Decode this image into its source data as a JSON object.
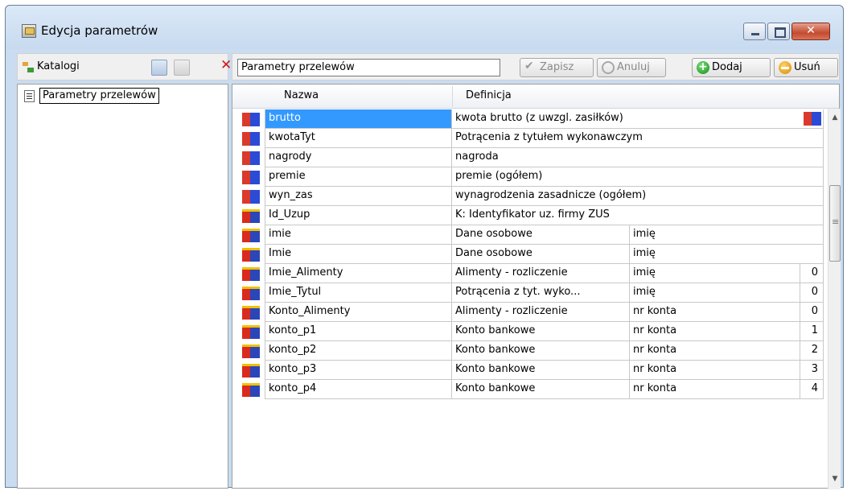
{
  "window": {
    "title": "Edycja parametrów"
  },
  "left_toolbar": {
    "label": "Katalogi"
  },
  "tree": {
    "items": [
      {
        "label": "Parametry przelewów"
      }
    ]
  },
  "right_toolbar": {
    "name_value": "Parametry przelewów",
    "save_label": "Zapisz",
    "cancel_label": "Anuluj",
    "add_label": "Dodaj",
    "delete_label": "Usuń"
  },
  "grid": {
    "columns": [
      "Nazwa",
      "Definicja"
    ],
    "rows": [
      {
        "type": "a",
        "name": "brutto",
        "definition": "kwota brutto (z uwzgl. zasiłków)",
        "field": "",
        "num": ""
      },
      {
        "type": "a",
        "name": "kwotaTyt",
        "definition": "Potrącenia z tytułem wykonawczym",
        "field": "",
        "num": ""
      },
      {
        "type": "a",
        "name": "nagrody",
        "definition": "nagroda",
        "field": "",
        "num": ""
      },
      {
        "type": "a",
        "name": "premie",
        "definition": "premie (ogółem)",
        "field": "",
        "num": ""
      },
      {
        "type": "a",
        "name": "wyn_zas",
        "definition": "wynagrodzenia zasadnicze (ogółem)",
        "field": "",
        "num": ""
      },
      {
        "type": "b",
        "name": "Id_Uzup",
        "definition": "K: Identyfikator uz. firmy ZUS",
        "field": "",
        "num": ""
      },
      {
        "type": "b",
        "name": "imie",
        "definition": "Dane osobowe",
        "field": "imię",
        "num": ""
      },
      {
        "type": "b",
        "name": "Imie",
        "definition": "Dane osobowe",
        "field": "imię",
        "num": ""
      },
      {
        "type": "b",
        "name": "Imie_Alimenty",
        "definition": "Alimenty - rozliczenie",
        "field": "imię",
        "num": "0"
      },
      {
        "type": "b",
        "name": "Imie_Tytul",
        "definition": "Potrącenia z tyt. wyko...",
        "field": "imię",
        "num": "0"
      },
      {
        "type": "b",
        "name": "Konto_Alimenty",
        "definition": "Alimenty - rozliczenie",
        "field": "nr konta",
        "num": "0"
      },
      {
        "type": "b",
        "name": "konto_p1",
        "definition": "Konto bankowe",
        "field": "nr konta",
        "num": "1"
      },
      {
        "type": "b",
        "name": "konto_p2",
        "definition": "Konto bankowe",
        "field": "nr konta",
        "num": "2"
      },
      {
        "type": "b",
        "name": "konto_p3",
        "definition": "Konto bankowe",
        "field": "nr konta",
        "num": "3"
      },
      {
        "type": "b",
        "name": "konto_p4",
        "definition": "Konto bankowe",
        "field": "nr konta",
        "num": "4"
      }
    ]
  }
}
